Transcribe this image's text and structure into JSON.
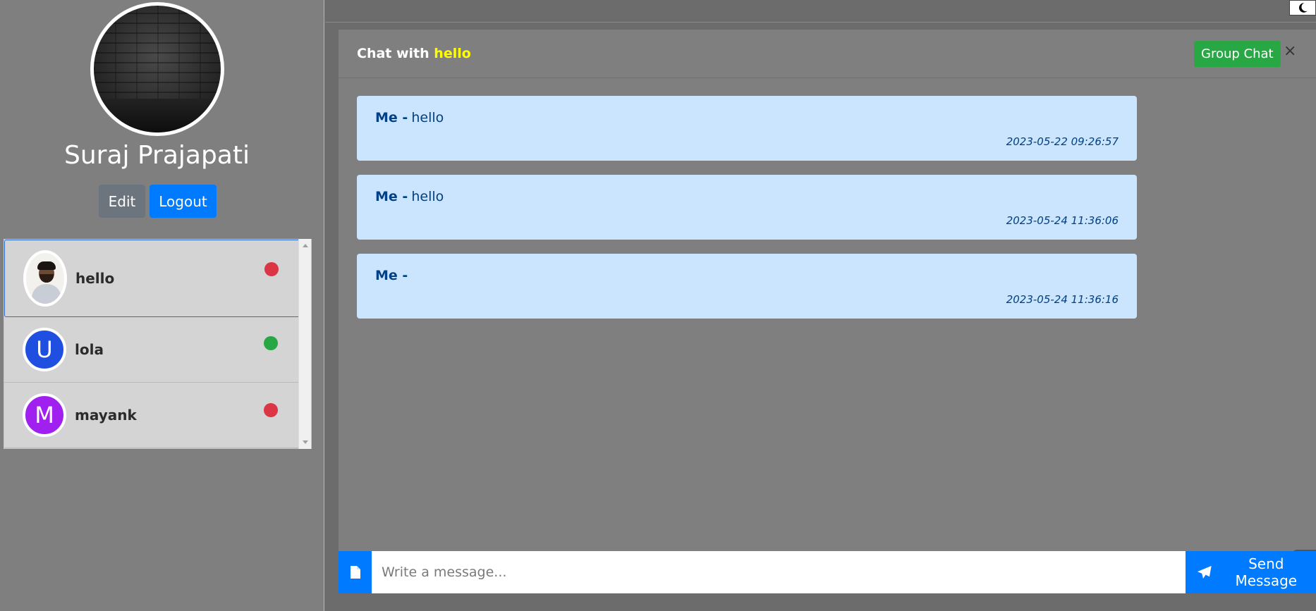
{
  "profile": {
    "name": "Suraj Prajapati",
    "edit_label": "Edit",
    "logout_label": "Logout"
  },
  "contacts": [
    {
      "name": "hello",
      "avatar_letter": "",
      "avatar_color": "#f3f1ee",
      "status_color": "#dc3545"
    },
    {
      "name": "lola",
      "avatar_letter": "U",
      "avatar_color": "#1f4fe0",
      "status_color": "#28a745"
    },
    {
      "name": "mayank",
      "avatar_letter": "M",
      "avatar_color": "#a020f0",
      "status_color": "#dc3545"
    }
  ],
  "chat": {
    "title_prefix": "Chat with",
    "title_user": "hello",
    "group_chat_label": "Group Chat",
    "close_label": "×"
  },
  "messages": [
    {
      "sender": "Me -",
      "text": "hello",
      "time": "2023-05-22 09:26:57"
    },
    {
      "sender": "Me -",
      "text": "hello",
      "time": "2023-05-24 11:36:06"
    },
    {
      "sender": "Me -",
      "text": "",
      "time": "2023-05-24 11:36:16"
    }
  ],
  "composer": {
    "placeholder": "Write a message...",
    "send_label": "Send Message"
  },
  "theme": {
    "moon_icon": "crescent-moon-icon"
  }
}
